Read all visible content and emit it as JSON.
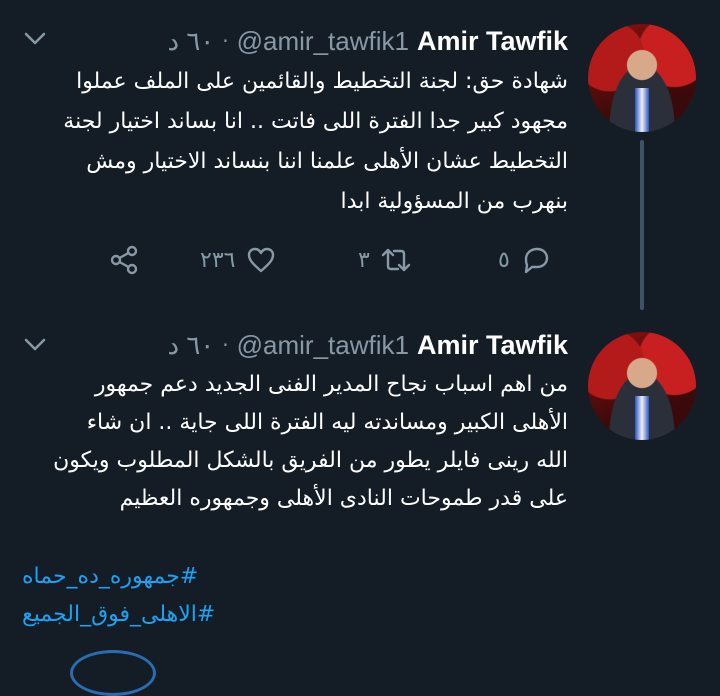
{
  "colors": {
    "background": "#141d26",
    "text": "#ffffff",
    "muted": "#8899a6",
    "link": "#1da1f2",
    "thread_line": "#3d5466"
  },
  "tweets": [
    {
      "name": "Amir Tawfik",
      "handle": "@amir_tawfik1",
      "time": "٦٠ د",
      "body": "شهادة حق: لجنة التخطيط والقائمين على الملف عملوا مجهود كبير جدا الفترة اللى فاتت .. انا بساند اختيار لجنة التخطيط عشان الأهلى علمنا اننا بنساند الاختيار ومش بنهرب من المسؤولية ابدا",
      "actions": {
        "reply_count": "٥",
        "retweet_count": "٣",
        "like_count": "٢٣٦"
      },
      "icons": [
        "chevron-down-icon",
        "reply-icon",
        "retweet-icon",
        "like-icon",
        "share-icon"
      ]
    },
    {
      "name": "Amir Tawfik",
      "handle": "@amir_tawfik1",
      "time": "٦٠ د",
      "body": "من اهم اسباب نجاح المدير الفنى الجديد دعم جمهور الأهلى الكبير ومساندته ليه الفترة اللى جاية .. ان شاء الله رينى فايلر يطور من الفريق بالشكل المطلوب ويكون على قدر طموحات النادى الأهلى وجمهوره العظيم",
      "hashtags": [
        "#جمهوره_ده_حماه",
        "#الاهلى_فوق_الجميع"
      ],
      "icons": [
        "chevron-down-icon"
      ]
    }
  ]
}
